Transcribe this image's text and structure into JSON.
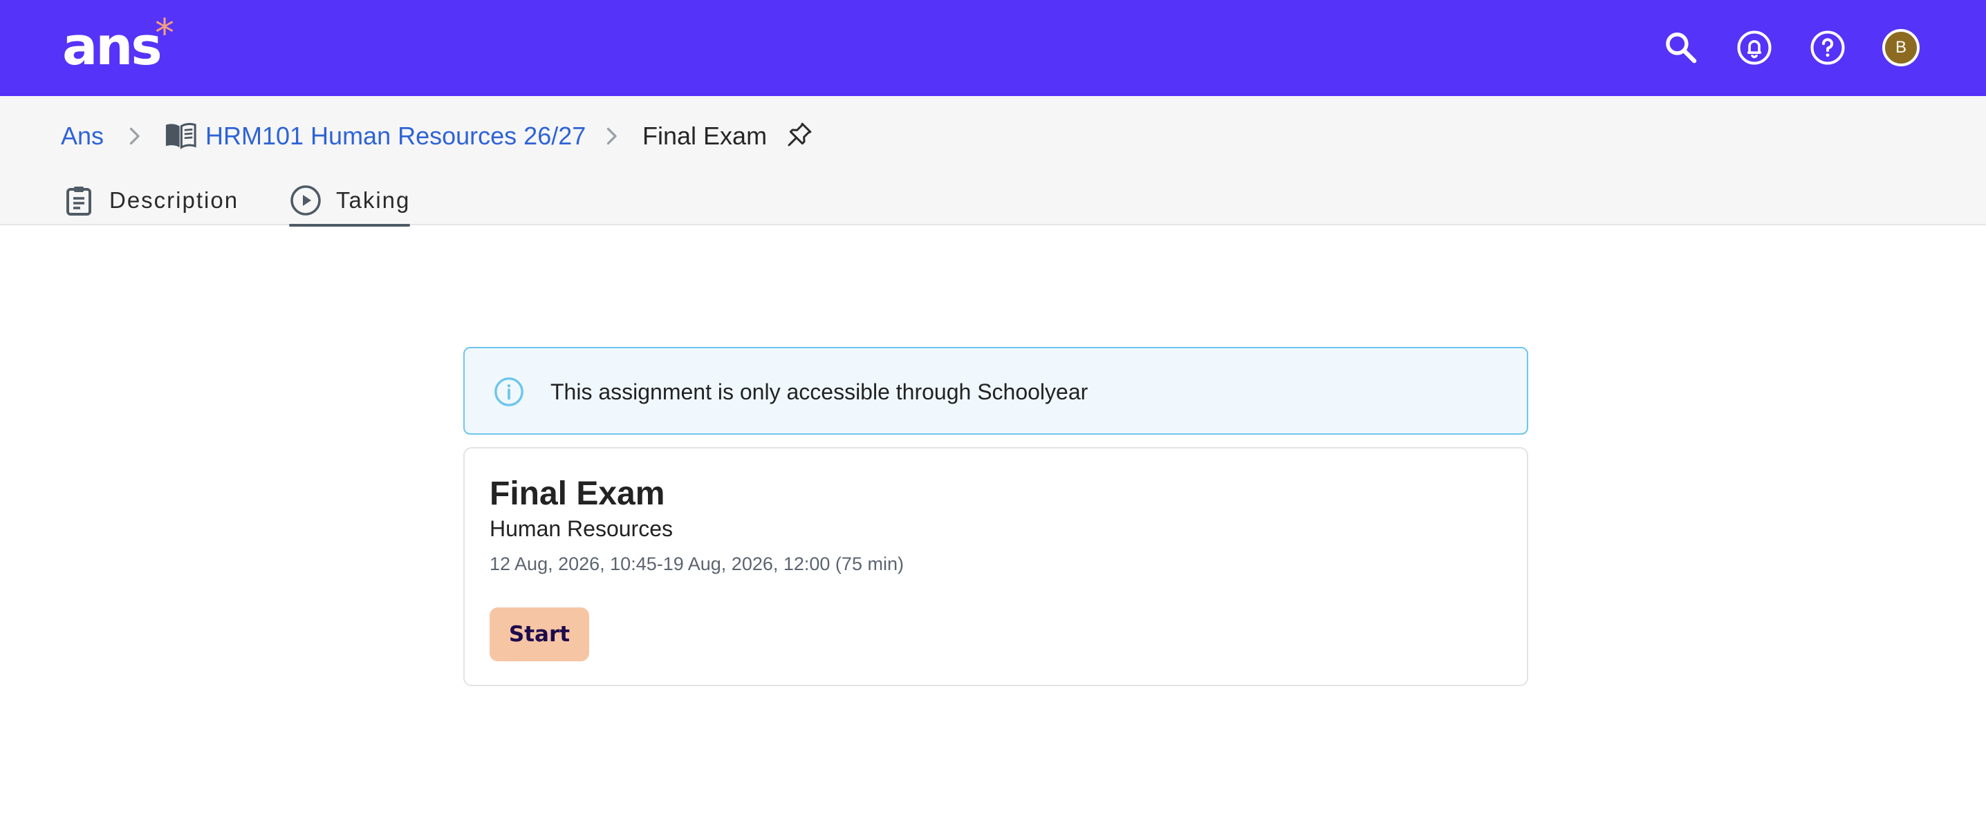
{
  "brand": {
    "logo_text": "ans",
    "logo_star": "*",
    "primary_color": "#5533f8",
    "accent_color": "#f7a07a"
  },
  "header": {
    "icons": [
      "search-icon",
      "notification-bell-icon",
      "help-icon"
    ],
    "avatar_initial": "B",
    "avatar_color": "#8c6b21"
  },
  "breadcrumb": {
    "items": [
      {
        "label": "Ans",
        "icon": null
      },
      {
        "label": "HRM101 Human Resources 26/27",
        "icon": "book-icon"
      },
      {
        "label": "Final Exam",
        "icon": null
      }
    ],
    "pin_icon": "pin-icon"
  },
  "tabs": [
    {
      "label": "Description",
      "icon": "clipboard-icon",
      "active": false
    },
    {
      "label": "Taking",
      "icon": "play-circle-icon",
      "active": true
    }
  ],
  "notice": {
    "icon": "info-icon",
    "text": "This assignment is only accessible through Schoolyear"
  },
  "assignment": {
    "title": "Final Exam",
    "course": "Human Resources",
    "dates": "12 Aug, 2026, 10:45-19 Aug, 2026, 12:00 (75 min)",
    "start_label": "Start",
    "start_color": "#f6c5a4"
  }
}
